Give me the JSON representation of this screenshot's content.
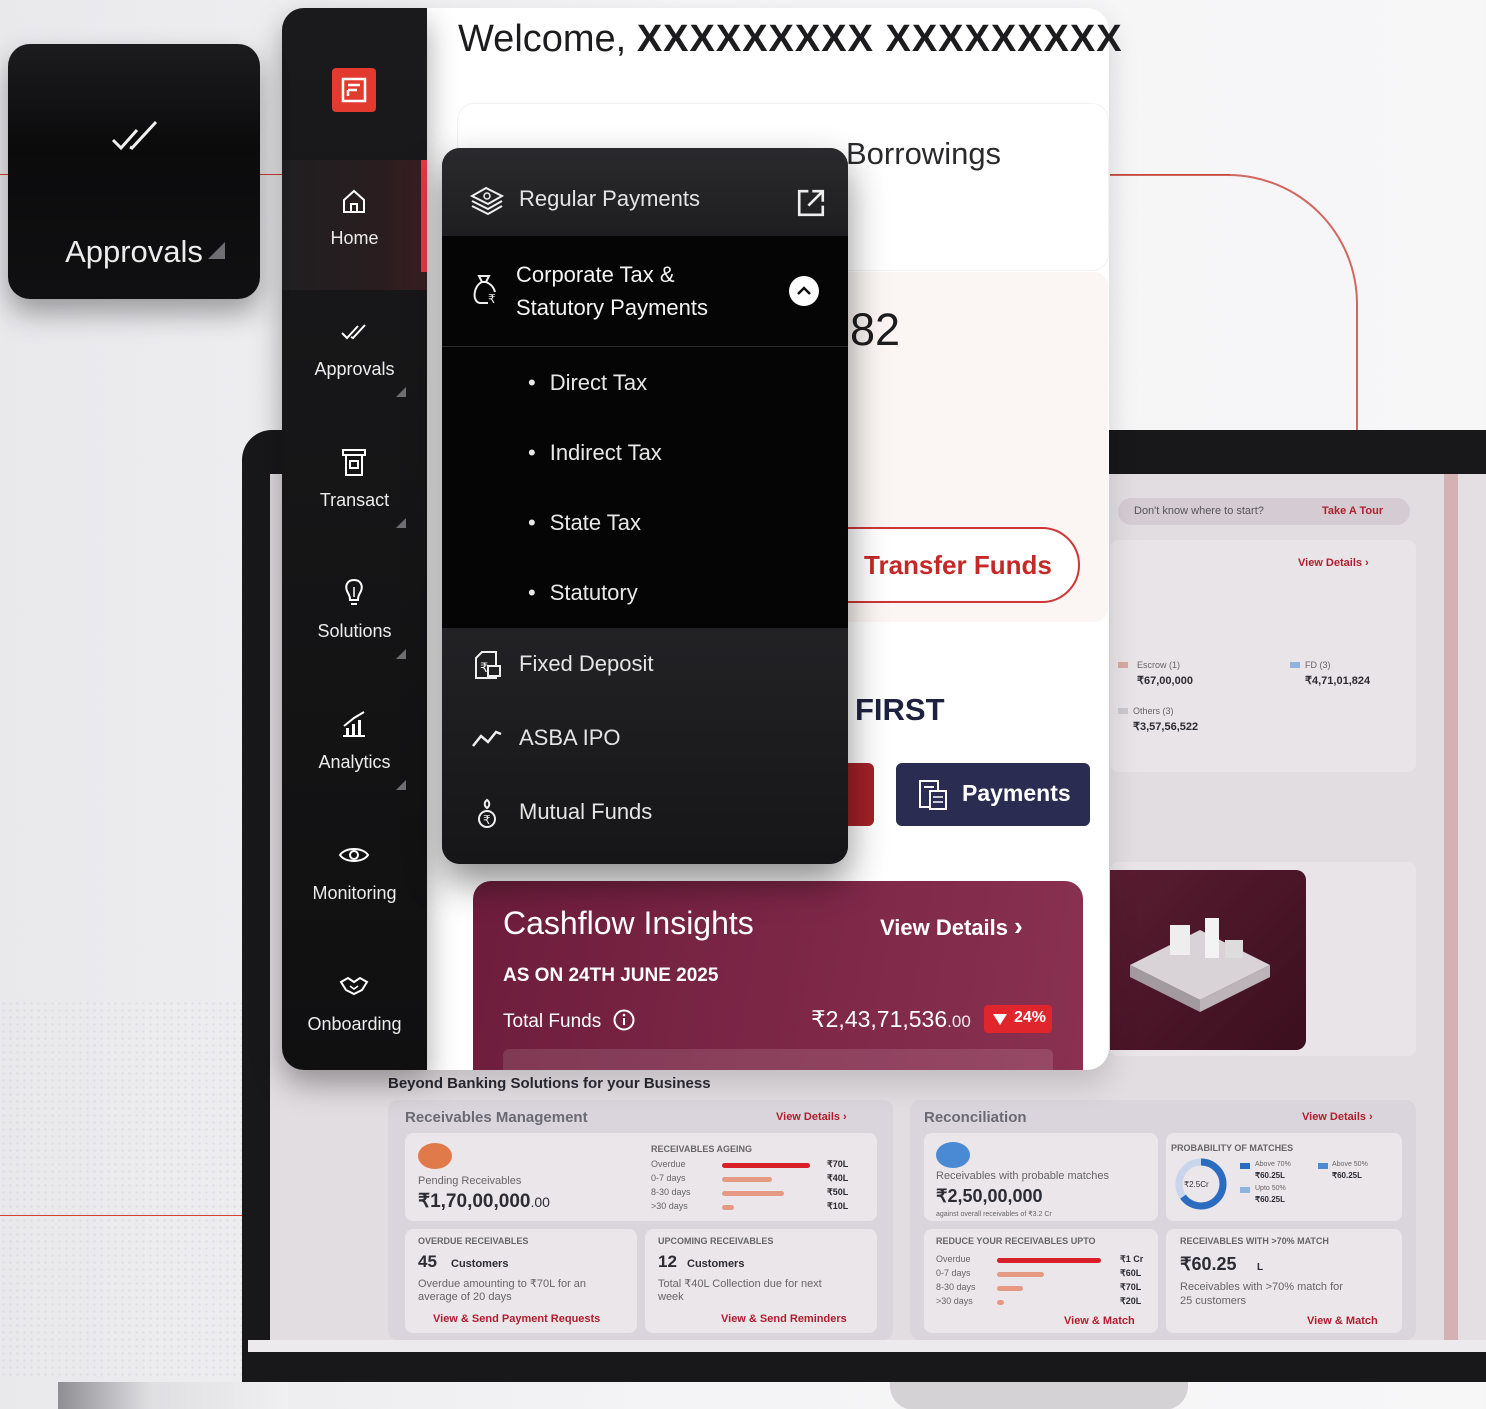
{
  "approvals_card": {
    "label": "Approvals"
  },
  "sidebar": {
    "items": [
      {
        "label": "Home",
        "icon": "home-icon",
        "active": true
      },
      {
        "label": "Approvals",
        "icon": "double-check-icon"
      },
      {
        "label": "Transact",
        "icon": "atm-icon"
      },
      {
        "label": "Solutions",
        "icon": "lightbulb-icon"
      },
      {
        "label": "Analytics",
        "icon": "chart-icon"
      },
      {
        "label": "Monitoring",
        "icon": "eye-icon"
      },
      {
        "label": "Onboarding",
        "icon": "handshake-icon"
      }
    ]
  },
  "header": {
    "welcome": "Welcome,",
    "user_name": "XXXXXXXXX XXXXXXXXX"
  },
  "main": {
    "tab_borrowings": "Borrowings",
    "balance_partial": "82",
    "transfer_button": "Transfer Funds",
    "first_text": "FIRST",
    "payments_button": "Payments"
  },
  "menu": {
    "regular_payments": "Regular Payments",
    "corporate_tax_line1": "Corporate Tax &",
    "corporate_tax_line2": "Statutory Payments",
    "sub_items": [
      "Direct Tax",
      "Indirect Tax",
      "State Tax",
      "Statutory"
    ],
    "fixed_deposit": "Fixed Deposit",
    "asba_ipo": "ASBA IPO",
    "mutual_funds": "Mutual Funds"
  },
  "cashflow": {
    "title": "Cashflow Insights",
    "view_details": "View Details",
    "as_on": "AS ON 24TH JUNE 2025",
    "total_funds_label": "Total Funds",
    "total_funds_value": "₹2,43,71,536",
    "total_funds_decimals": ".00",
    "change_badge": "24%",
    "change_direction": "down",
    "accent": "#e0262c"
  },
  "screen": {
    "tour_question": "Don't know where to start?",
    "tour_link": "Take A Tour",
    "view_details": "View Details",
    "legend": [
      {
        "label": "Escrow (1)",
        "value": "₹67,00,000",
        "color": "#d9a9a0"
      },
      {
        "label": "FD (3)",
        "value": "₹4,71,01,824",
        "color": "#8fb3dd"
      },
      {
        "label": "Others (3)",
        "value": "₹3,57,56,522",
        "color": "#c9c9cf"
      }
    ],
    "beyond_banking": "Beyond Banking Solutions for your Business",
    "receivables": {
      "title": "Receivables Management",
      "view_details": "View Details",
      "pending_label": "Pending Receivables",
      "pending_value": "₹1,70,00,000",
      "pending_decimals": ".00",
      "ageing_title": "RECEIVABLES AGEING",
      "ageing": [
        {
          "label": "Overdue",
          "value": "₹70L",
          "fraction": 1.0
        },
        {
          "label": "0-7 days",
          "value": "₹40L",
          "fraction": 0.57
        },
        {
          "label": "8-30 days",
          "value": "₹50L",
          "fraction": 0.71
        },
        {
          "label": ">30 days",
          "value": "₹10L",
          "fraction": 0.14
        }
      ],
      "overdue_title": "OVERDUE RECEIVABLES",
      "overdue_count": "45",
      "overdue_unit": "Customers",
      "overdue_text_1": "Overdue amounting to ₹70L for an",
      "overdue_text_2": "average of 20 days",
      "overdue_link": "View & Send Payment Requests",
      "upcoming_title": "UPCOMING RECEIVABLES",
      "upcoming_count": "12",
      "upcoming_unit": "Customers",
      "upcoming_text_1": "Total ₹40L Collection due for next",
      "upcoming_text_2": "week",
      "upcoming_link": "View & Send Reminders"
    },
    "reconciliation": {
      "title": "Reconciliation",
      "view_details": "View Details",
      "probable_label": "Receivables with probable matches",
      "probable_value": "₹2,50,00,000",
      "probable_note": "against overall receivables of ₹3.2 Cr",
      "prob_title": "PROBABILITY OF MATCHES",
      "donut_center": "₹2.5Cr",
      "prob_legend": [
        {
          "label": "Above 70%",
          "value": "₹60.25L"
        },
        {
          "label": "Above 50%",
          "value": "₹60.25L"
        },
        {
          "label": "Upto 50%",
          "value": "₹60.25L"
        }
      ],
      "reduce_title": "REDUCE YOUR RECEIVABLES UPTO",
      "reduce": [
        {
          "label": "Overdue",
          "value": "₹1 Cr",
          "fraction": 1.0
        },
        {
          "label": "0-7 days",
          "value": "₹60L",
          "fraction": 0.45
        },
        {
          "label": "8-30 days",
          "value": "₹70L",
          "fraction": 0.25
        },
        {
          "label": ">30 days",
          "value": "₹20L",
          "fraction": 0.07
        }
      ],
      "reduce_link": "View & Match",
      "match_title": "RECEIVABLES WITH >70% MATCH",
      "match_value": "₹60.25",
      "match_unit": "L",
      "match_text_1": "Receivables with >70% match for",
      "match_text_2": "25 customers",
      "match_link": "View & Match"
    }
  }
}
